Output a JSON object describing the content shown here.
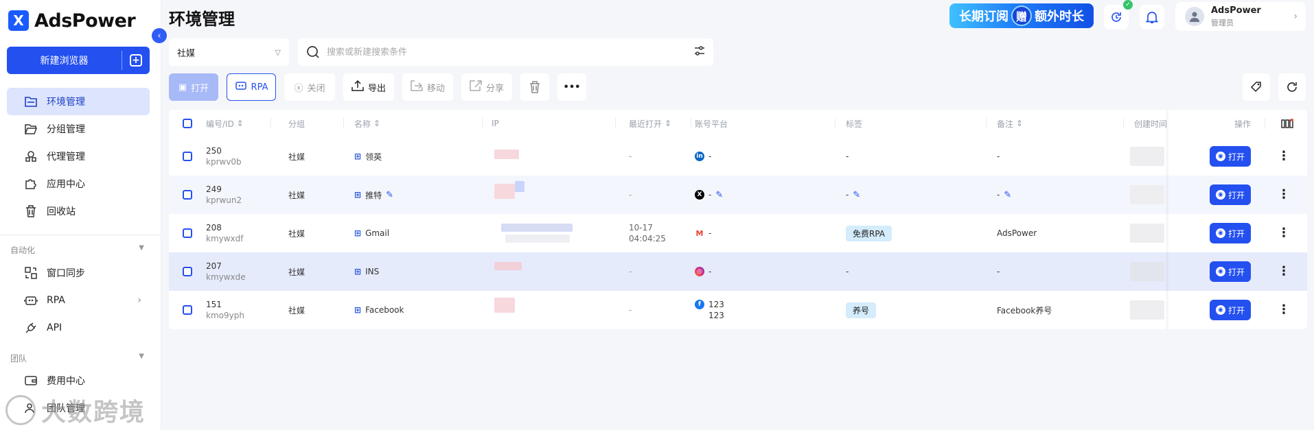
{
  "app": {
    "logo_text": "AdsPower",
    "logo_mark": "X"
  },
  "sidebar": {
    "new_browser_label": "新建浏览器",
    "items": [
      {
        "label": "环境管理",
        "icon": "folder-icon"
      },
      {
        "label": "分组管理",
        "icon": "folder-open-icon"
      },
      {
        "label": "代理管理",
        "icon": "proxy-icon"
      },
      {
        "label": "应用中心",
        "icon": "puzzle-icon"
      },
      {
        "label": "回收站",
        "icon": "trash-icon"
      },
      {
        "label": "窗口同步",
        "icon": "sync-icon"
      },
      {
        "label": "RPA",
        "icon": "robot-icon"
      },
      {
        "label": "API",
        "icon": "plug-icon"
      },
      {
        "label": "费用中心",
        "icon": "wallet-icon"
      },
      {
        "label": "团队管理",
        "icon": "team-icon"
      }
    ],
    "sections": {
      "automation": "自动化",
      "team": "团队"
    }
  },
  "watermark": "大数跨境",
  "header": {
    "title": "环境管理",
    "promo_left": "长期订阅",
    "promo_gift": "赠",
    "promo_right": "额外时长",
    "user_name": "AdsPower",
    "user_role": "管理员"
  },
  "filters": {
    "group_value": "社媒",
    "search_placeholder": "搜索或新建搜索条件"
  },
  "toolbar": {
    "open": "打开",
    "rpa": "RPA",
    "close": "关闭",
    "export": "导出",
    "move": "移动",
    "share": "分享",
    "more": "•••"
  },
  "table": {
    "columns": {
      "id": "编号/ID",
      "group": "分组",
      "name": "名称",
      "ip": "IP",
      "last_open": "最近打开",
      "platform": "账号平台",
      "tags": "标签",
      "notes": "备注",
      "created": "创建时间",
      "actions": "操作"
    },
    "open_label": "打开",
    "rows": [
      {
        "id": "250",
        "code": "kprwv0b",
        "group": "社媒",
        "name": "领英",
        "last_open": "-",
        "last_open_time": "",
        "platform_icon": "linkedin-icon",
        "platform_text": "-",
        "platform_sub": "",
        "tag": "-",
        "note": "-"
      },
      {
        "id": "249",
        "code": "kprwun2",
        "group": "社媒",
        "name": "推特",
        "last_open": "-",
        "last_open_time": "",
        "platform_icon": "x-icon",
        "platform_text": "-",
        "platform_sub": "",
        "tag": "-",
        "note": "-"
      },
      {
        "id": "208",
        "code": "kmywxdf",
        "group": "社媒",
        "name": "Gmail",
        "last_open": "10-17",
        "last_open_time": "04:04:25",
        "platform_icon": "gmail-icon",
        "platform_text": "-",
        "platform_sub": "",
        "tag": "免费RPA",
        "note": "AdsPower"
      },
      {
        "id": "207",
        "code": "kmywxde",
        "group": "社媒",
        "name": "INS",
        "last_open": "-",
        "last_open_time": "",
        "platform_icon": "instagram-icon",
        "platform_text": "-",
        "platform_sub": "",
        "tag": "-",
        "note": "-"
      },
      {
        "id": "151",
        "code": "kmo9yph",
        "group": "社媒",
        "name": "Facebook",
        "last_open": "-",
        "last_open_time": "",
        "platform_icon": "facebook-icon",
        "platform_text": "123",
        "platform_sub": "123",
        "tag": "养号",
        "note": "Facebook养号"
      }
    ]
  },
  "colors": {
    "primary": "#2450f0",
    "active_nav_bg": "#dde4fd",
    "tag_bg": "#d4ecfb"
  }
}
